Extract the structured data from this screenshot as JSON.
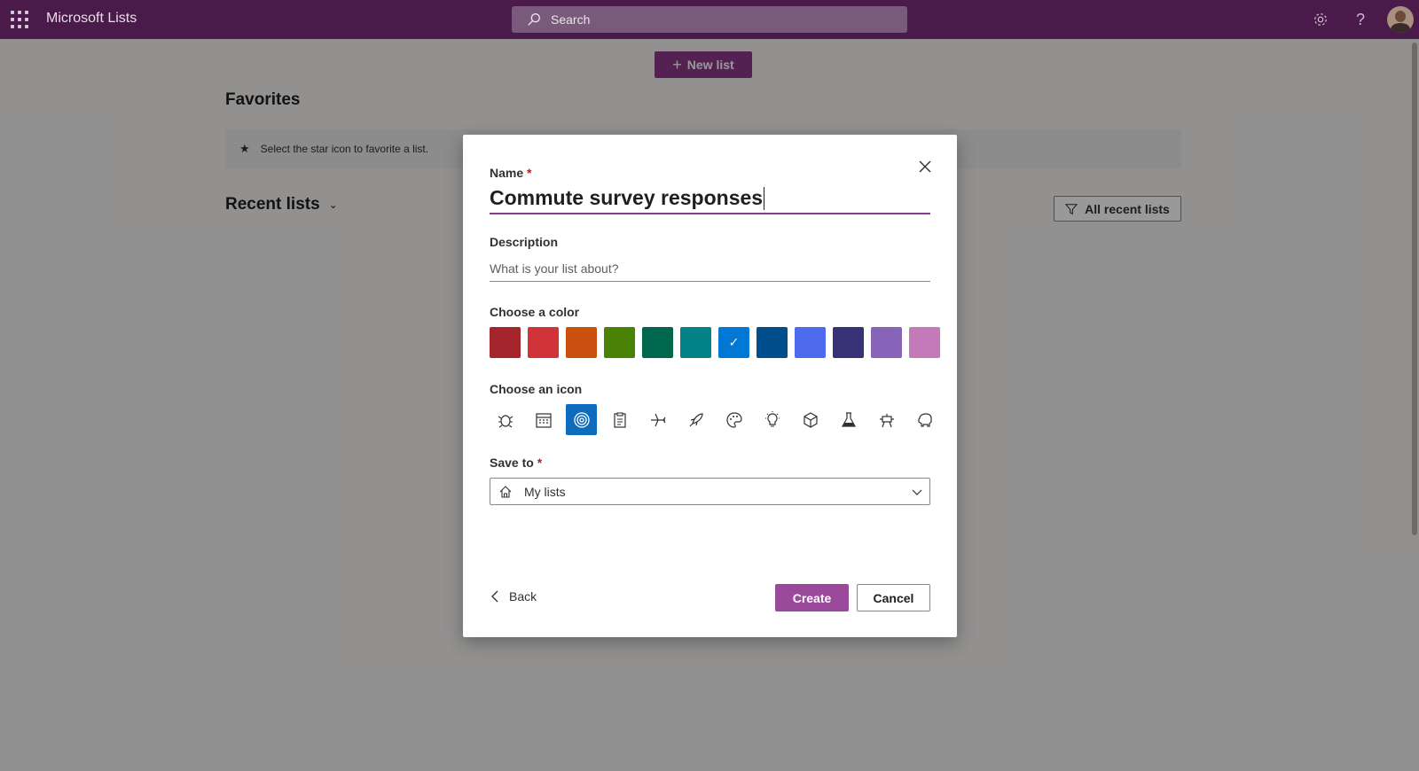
{
  "topbar": {
    "app_title": "Microsoft Lists",
    "search_placeholder": "Search",
    "icons": [
      "waffle-icon",
      "search-icon",
      "gear-icon",
      "help-icon",
      "avatar"
    ],
    "color": "#4a1a4a"
  },
  "page": {
    "new_list_label": "New list",
    "favorites_heading": "Favorites",
    "favorites_hint": "Select the star icon to favorite a list.",
    "recent_heading": "Recent lists",
    "recent_filter_label": "All recent lists"
  },
  "dialog": {
    "name_label": "Name",
    "required_marker": "*",
    "name_value": "Commute survey responses",
    "description_label": "Description",
    "description_placeholder": "What is your list about?",
    "color_label": "Choose a color",
    "colors": [
      "#a4262c",
      "#d13438",
      "#ca5010",
      "#498205",
      "#00674f",
      "#038387",
      "#0078d4",
      "#004e8c",
      "#4f6bed",
      "#373277",
      "#8764b8",
      "#c27ab8"
    ],
    "selected_color_index": 6,
    "icon_label": "Choose an icon",
    "icons": [
      "bug-icon",
      "calendar-icon",
      "target-icon",
      "clipboard-icon",
      "airplane-icon",
      "rocket-icon",
      "palette-icon",
      "lightbulb-icon",
      "cube-icon",
      "beaker-icon",
      "robot-icon",
      "piggy-bank-icon"
    ],
    "selected_icon_index": 2,
    "save_to_label": "Save to",
    "save_to_value": "My lists",
    "back_label": "Back",
    "create_label": "Create",
    "cancel_label": "Cancel",
    "accent_color": "#8b3a8b"
  }
}
